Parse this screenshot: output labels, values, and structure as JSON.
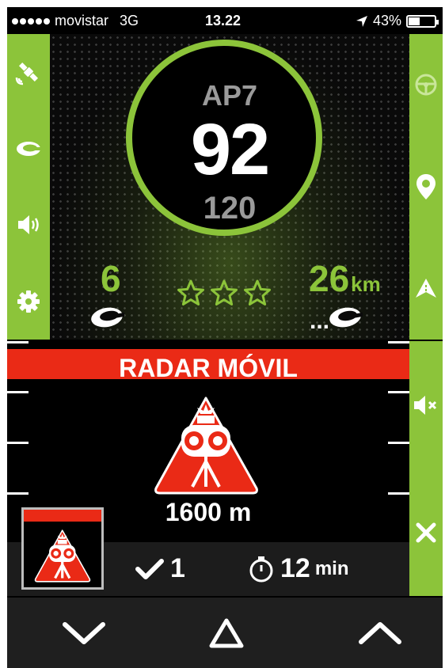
{
  "status_bar": {
    "carrier": "movistar",
    "network": "3G",
    "time": "13.22",
    "battery": "43%"
  },
  "left_sidebar": [
    "satellite-icon",
    "community-c-icon",
    "volume-icon",
    "settings-gear-icon"
  ],
  "right_sidebar_top": [
    "steering-wheel-icon",
    "location-pin-icon",
    "navigation-arrow-icon"
  ],
  "right_sidebar_bottom": [
    "mute-icon",
    "close-icon"
  ],
  "speed_panel": {
    "road": "AP7",
    "current_speed": "92",
    "speed_limit": "120",
    "users_count": "6",
    "distance_value": "26",
    "distance_unit": "km",
    "stars": 3,
    "accent_color": "#8cc43a"
  },
  "alert": {
    "title": "RADAR MÓVIL",
    "distance": "1600 m",
    "color": "#ea2a16"
  },
  "info_bar": {
    "confirmations": "1",
    "time_value": "12",
    "time_unit": "min"
  },
  "bottom_nav": [
    "chevron-down-icon",
    "triangle-icon",
    "chevron-up-icon"
  ]
}
